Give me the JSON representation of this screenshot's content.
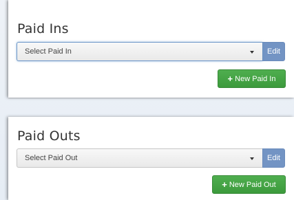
{
  "paid_ins": {
    "title": "Paid Ins",
    "select_value": "Select Paid In",
    "edit_label": "Edit",
    "new_icon": "+",
    "new_label": "New Paid In"
  },
  "paid_outs": {
    "title": "Paid Outs",
    "select_value": "Select Paid Out",
    "edit_label": "Edit",
    "new_icon": "+",
    "new_label": "New Paid Out"
  },
  "colors": {
    "edit_button": "#7394c4",
    "new_button": "#46a546",
    "focus_border": "#6c96c8"
  },
  "icons": {
    "caret": "caret-down-icon",
    "plus": "plus-icon"
  }
}
